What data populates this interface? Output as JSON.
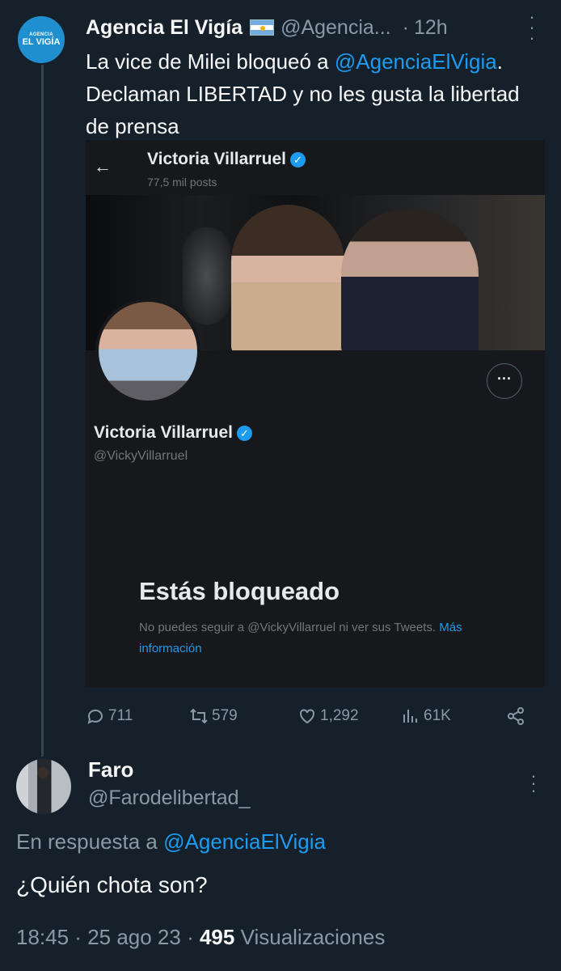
{
  "tweet": {
    "author_name": "Agencia El Vigía",
    "avatar_text_small": "AGENCIA",
    "avatar_text_big": "EL VIGÍA",
    "handle": "@Agencia...",
    "dot": "·",
    "time": "12h",
    "text_part1": "La vice de Milei bloqueó a ",
    "mention": "@AgenciaElVigia",
    "text_part2": ". Declaman LIBERTAD y no les gusta la libertad de prensa"
  },
  "card": {
    "header_name": "Victoria Villarruel",
    "posts": "77,5 mil posts",
    "profile_name": "Victoria Villarruel",
    "profile_handle": "@VickyVillarruel",
    "blocked_title": "Estás bloqueado",
    "blocked_text": "No puedes seguir a @VickyVillarruel ni ver sus Tweets. ",
    "blocked_link": "Más información"
  },
  "actions": {
    "replies": "711",
    "retweets": "579",
    "likes": "1,292",
    "views": "61K"
  },
  "reply": {
    "name": "Faro",
    "handle": "@Farodelibertad_",
    "in_reply_prefix": "En respuesta a ",
    "in_reply_mention": "@AgenciaElVigia",
    "text": "¿Quién chota son?",
    "time": "18:45",
    "sep1": " · ",
    "date": "25 ago 23",
    "sep2": " · ",
    "views_count": "495",
    "views_label": " Visualizaciones"
  },
  "colors": {
    "background": "#15202b",
    "link": "#1d9bf0",
    "muted": "#8b98a5"
  },
  "icons": [
    "more-icon",
    "back-arrow-icon",
    "verified-badge-icon",
    "reply-icon",
    "retweet-icon",
    "like-icon",
    "views-icon",
    "share-icon"
  ]
}
